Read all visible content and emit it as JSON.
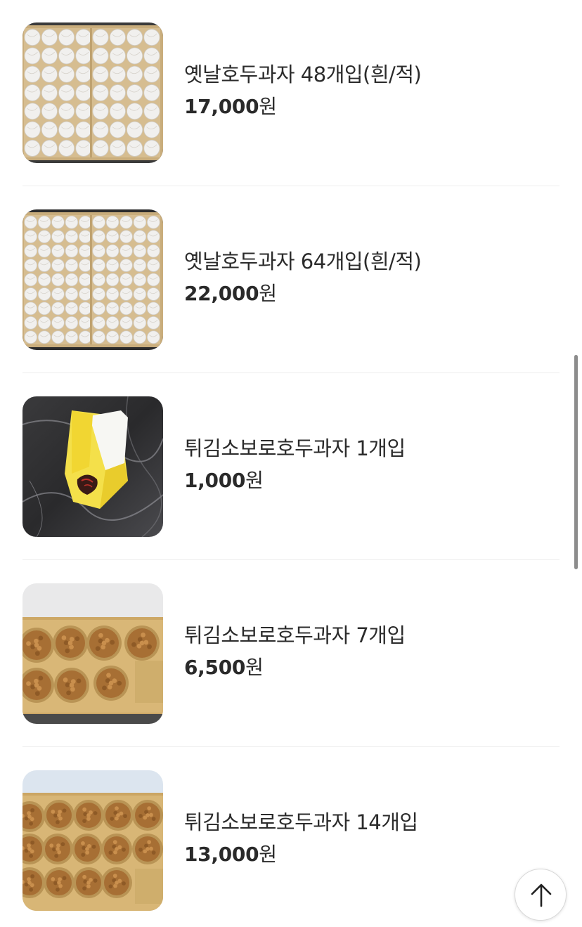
{
  "products": [
    {
      "name": "옛날호두과자 48개입(흰/적)",
      "price_amount": "17,000",
      "price_unit": "원",
      "image_icon": "wrapped-walnut-cakes-48-box"
    },
    {
      "name": "옛날호두과자 64개입(흰/적)",
      "price_amount": "22,000",
      "price_unit": "원",
      "image_icon": "wrapped-walnut-cakes-64-box"
    },
    {
      "name": "튀김소보로호두과자 1개입",
      "price_amount": "1,000",
      "price_unit": "원",
      "image_icon": "single-wrapped-pastry"
    },
    {
      "name": "튀김소보로호두과자 7개입",
      "price_amount": "6,500",
      "price_unit": "원",
      "image_icon": "fried-soboro-7-tray"
    },
    {
      "name": "튀김소보로호두과자 14개입",
      "price_amount": "13,000",
      "price_unit": "원",
      "image_icon": "fried-soboro-14-tray"
    }
  ],
  "scroll_to_top": {
    "icon": "arrow-up-icon"
  },
  "colors": {
    "background": "#ffffff",
    "text": "#2b2b2b",
    "divider": "#eeeeee",
    "scrollbar": "#8c8c8c"
  }
}
